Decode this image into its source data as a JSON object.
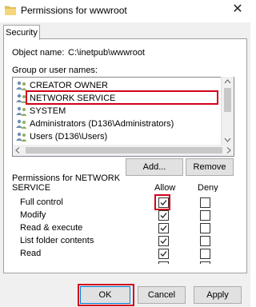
{
  "window": {
    "title": "Permissions for wwwroot",
    "close_glyph": "✕"
  },
  "tabs": [
    {
      "label": "Security"
    }
  ],
  "object": {
    "label": "Object name:",
    "value": "C:\\inetpub\\wwwroot"
  },
  "group_list": {
    "label": "Group or user names:",
    "items": [
      {
        "label": "CREATOR OWNER",
        "icon": "users-icon"
      },
      {
        "label": "NETWORK SERVICE",
        "icon": "users-icon",
        "selected": true
      },
      {
        "label": "SYSTEM",
        "icon": "users-icon"
      },
      {
        "label": "Administrators (D136\\Administrators)",
        "icon": "users-icon"
      },
      {
        "label": "Users (D136\\Users)",
        "icon": "users-icon"
      }
    ]
  },
  "buttons": {
    "add": "Add...",
    "remove": "Remove",
    "ok": "OK",
    "cancel": "Cancel",
    "apply": "Apply"
  },
  "permissions": {
    "label_line1": "Permissions for NETWORK",
    "label_line2": "SERVICE",
    "allow_header": "Allow",
    "deny_header": "Deny",
    "rows": [
      {
        "name": "Full control",
        "allow": true,
        "deny": false
      },
      {
        "name": "Modify",
        "allow": true,
        "deny": false
      },
      {
        "name": "Read & execute",
        "allow": true,
        "deny": false
      },
      {
        "name": "List folder contents",
        "allow": true,
        "deny": false
      },
      {
        "name": "Read",
        "allow": true,
        "deny": false
      }
    ]
  },
  "colors": {
    "highlight": "#d0021b",
    "accent": "#0078d7"
  }
}
